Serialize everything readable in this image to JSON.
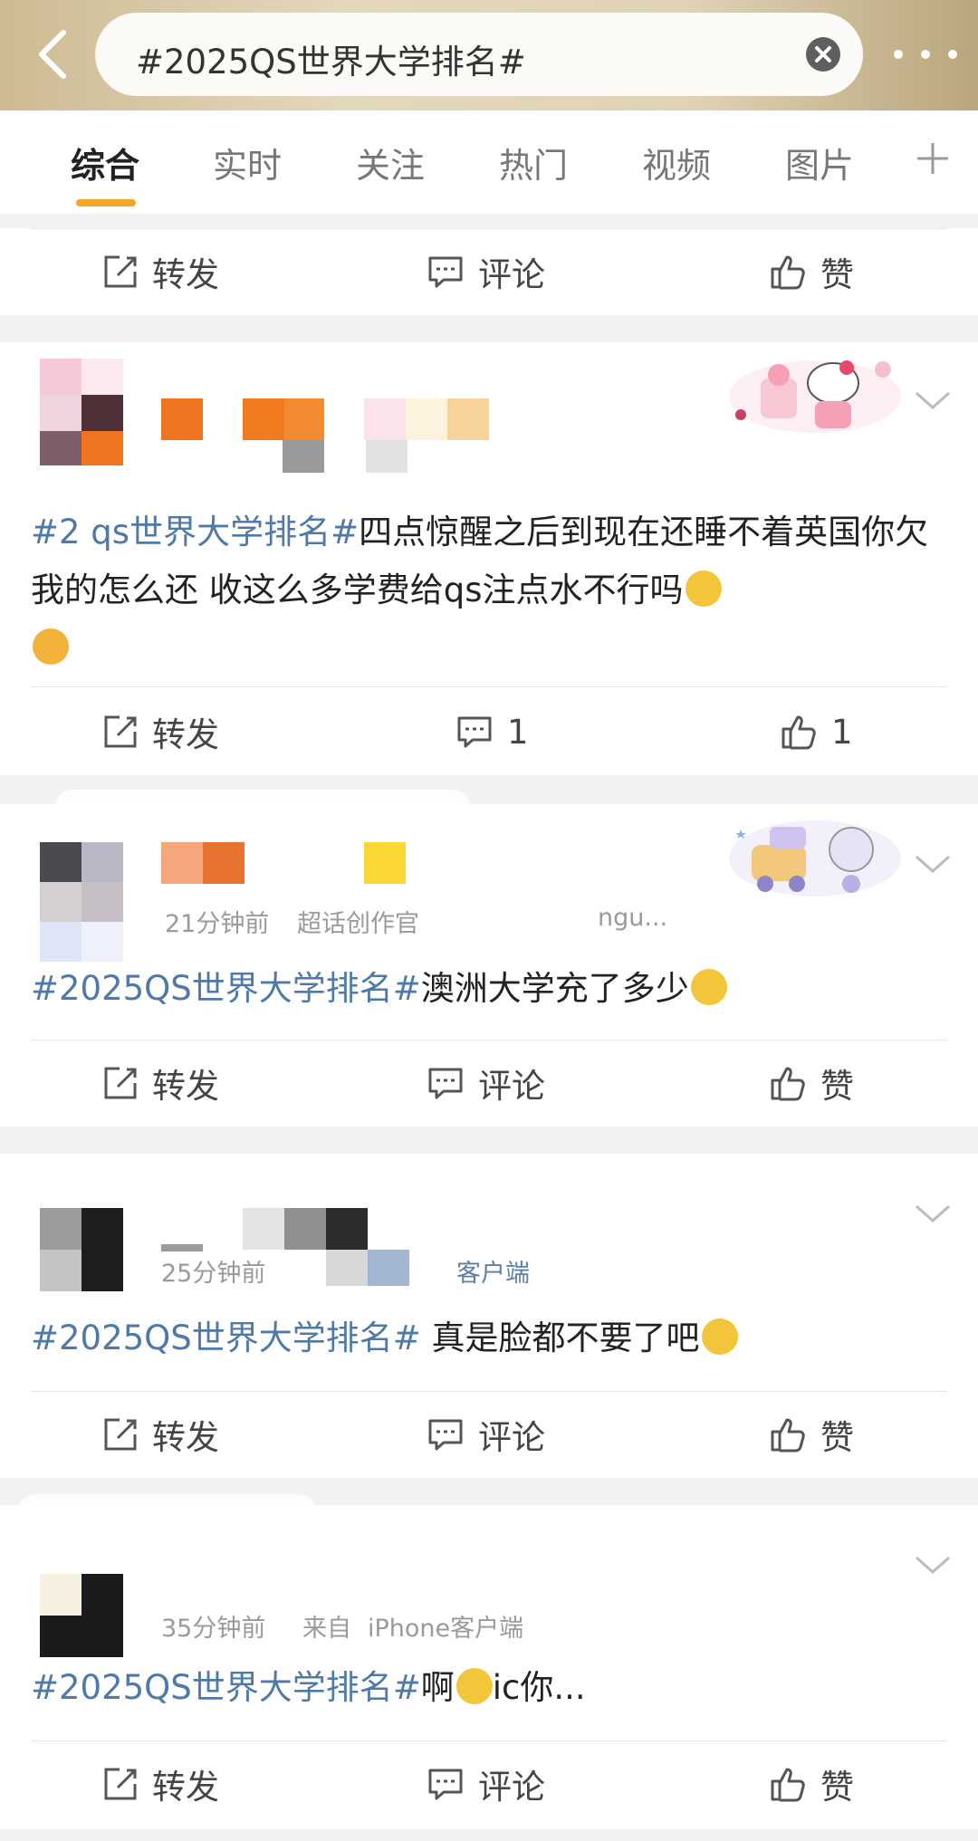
{
  "search": {
    "query": "#2025QS世界大学排名#"
  },
  "tabs": [
    {
      "label": "综合",
      "active": true
    },
    {
      "label": "实时",
      "active": false
    },
    {
      "label": "关注",
      "active": false
    },
    {
      "label": "热门",
      "active": false
    },
    {
      "label": "视频",
      "active": false
    },
    {
      "label": "图片",
      "active": false
    }
  ],
  "labels": {
    "repost": "转发",
    "comment": "评论",
    "like": "赞"
  },
  "posts": [
    {
      "meta_time": "",
      "meta_source": "",
      "hashtag": "#2 qs世界大学排名#",
      "text": "四点惊醒之后到现在还睡不着英国你欠我的怎么还 收这么多学费给qs注点水不行吗",
      "comment_count": "1",
      "like_count": "1"
    },
    {
      "meta_time": "21分钟前",
      "meta_extra": "超话创作官",
      "meta_tail": "ngu...",
      "hashtag": "#2025QS世界大学排名#",
      "text": "澳洲大学充了多少"
    },
    {
      "meta_time": "25分钟前",
      "meta_source": "客户端",
      "hashtag": "#2025QS世界大学排名#",
      "text": " 真是脸都不要了吧"
    },
    {
      "meta_time": "35分钟前",
      "meta_from": "来自",
      "meta_source": "iPhone客户端",
      "hashtag": "#2025QS世界大学排名#",
      "text": "啊",
      "text_tail": "ic你..."
    }
  ],
  "colors": {
    "accent": "#f5a623",
    "hashtag": "#4f79a8",
    "header_bg": "#dccfb0"
  }
}
